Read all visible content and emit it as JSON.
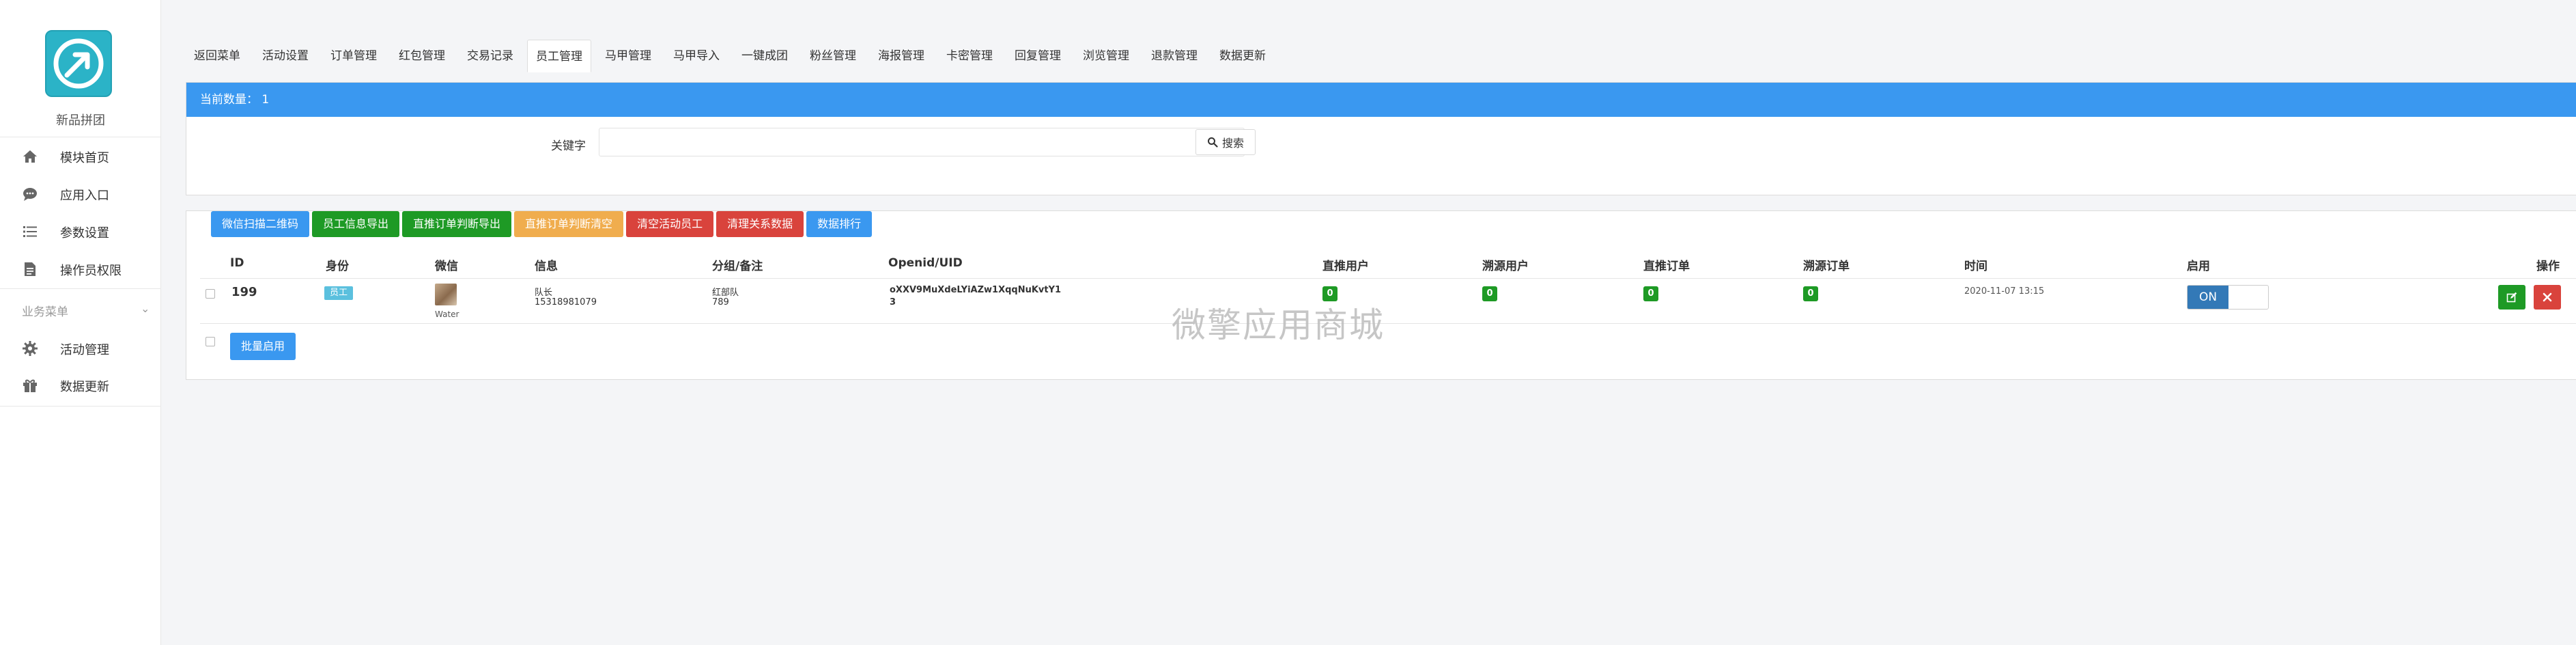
{
  "brand": {
    "name": "新品拼团"
  },
  "sidebar": {
    "items": [
      {
        "label": "模块首页",
        "icon": "home-icon"
      },
      {
        "label": "应用入口",
        "icon": "chat-icon"
      },
      {
        "label": "参数设置",
        "icon": "list-icon"
      },
      {
        "label": "操作员权限",
        "icon": "doc-icon"
      }
    ],
    "group_label": "业务菜单",
    "group_items": [
      {
        "label": "活动管理",
        "icon": "gear-icon"
      },
      {
        "label": "数据更新",
        "icon": "gift-icon"
      }
    ]
  },
  "tabs": [
    "返回菜单",
    "活动设置",
    "订单管理",
    "红包管理",
    "交易记录",
    "员工管理",
    "马甲管理",
    "马甲导入",
    "一键成团",
    "粉丝管理",
    "海报管理",
    "卡密管理",
    "回复管理",
    "浏览管理",
    "退款管理",
    "数据更新"
  ],
  "active_tab": "员工管理",
  "panel": {
    "count_label": "当前数量：",
    "count_value": "1",
    "keyword_label": "关键字",
    "keyword_value": "",
    "search_label": "搜索"
  },
  "actions": [
    {
      "label": "微信扫描二维码",
      "color": "blue"
    },
    {
      "label": "员工信息导出",
      "color": "green"
    },
    {
      "label": "直推订单判断导出",
      "color": "green"
    },
    {
      "label": "直推订单判断清空",
      "color": "orange"
    },
    {
      "label": "清空活动员工",
      "color": "red"
    },
    {
      "label": "清理关系数据",
      "color": "red"
    },
    {
      "label": "数据排行",
      "color": "blue"
    }
  ],
  "table": {
    "headers": {
      "id": "ID",
      "role": "身份",
      "wechat": "微信",
      "info": "信息",
      "group": "分组/备注",
      "openid": "Openid/UID",
      "direct_users": "直推用户",
      "source_users": "溯源用户",
      "direct_orders": "直推订单",
      "source_orders": "溯源订单",
      "time": "时间",
      "enabled": "启用",
      "ops": "操作"
    },
    "rows": [
      {
        "id": "199",
        "role": "员工",
        "wechat_name": "Water",
        "info_name": "队长",
        "info_phone": "15318981079",
        "group_name": "红部队",
        "group_note": "789",
        "openid_line1": "oXXV9MuXdeLYiAZw1XqqNuKvtY1",
        "openid_line2": "3",
        "direct_users": "0",
        "source_users": "0",
        "direct_orders": "0",
        "source_orders": "0",
        "time": "2020-11-07 13:15",
        "enabled_label": "ON"
      }
    ]
  },
  "bulk_enable_label": "批量启用",
  "watermark": "微擎应用商城",
  "colors": {
    "primary": "#3a98f0",
    "green": "#1e9a25",
    "orange": "#f0ad4e",
    "red": "#d9433c",
    "info": "#5bc0de",
    "logo": "#2bb3c7"
  }
}
